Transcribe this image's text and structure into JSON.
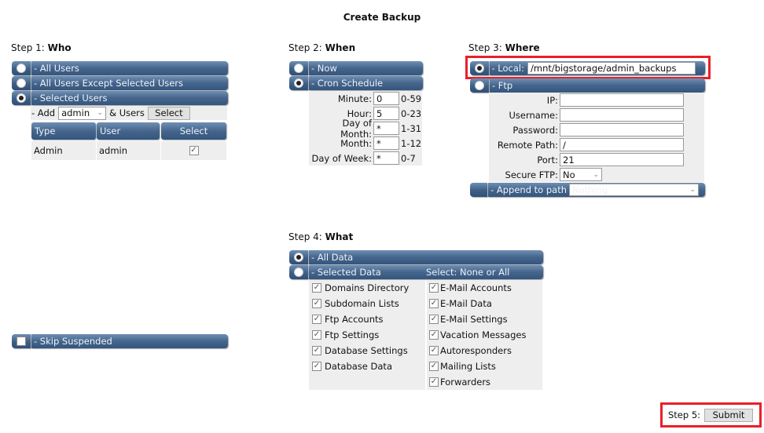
{
  "page": {
    "title": "Create Backup"
  },
  "step1": {
    "label": "Step 1:",
    "heading": "Who",
    "options": [
      {
        "label": "- All Users",
        "selected": false
      },
      {
        "label": "- All Users Except Selected Users",
        "selected": false
      },
      {
        "label": "- Selected Users",
        "selected": true
      }
    ],
    "add_label": "- Add",
    "add_select_value": "admin",
    "and_users_label": "& Users",
    "select_button": "Select",
    "table": {
      "headers": [
        "Type",
        "User",
        "Select"
      ],
      "rows": [
        {
          "type": "Admin",
          "user": "admin",
          "checked": true
        }
      ]
    },
    "skip_suspended": {
      "label": "- Skip Suspended",
      "checked": false
    }
  },
  "step2": {
    "label": "Step 2:",
    "heading": "When",
    "options": [
      {
        "label": "- Now",
        "selected": false
      },
      {
        "label": "- Cron Schedule",
        "selected": true
      }
    ],
    "cron": [
      {
        "label": "Minute:",
        "value": "0",
        "range": "0-59"
      },
      {
        "label": "Hour:",
        "value": "5",
        "range": "0-23"
      },
      {
        "label": "Day of Month:",
        "value": "*",
        "range": "1-31"
      },
      {
        "label": "Month:",
        "value": "*",
        "range": "1-12"
      },
      {
        "label": "Day of Week:",
        "value": "*",
        "range": "0-7"
      }
    ]
  },
  "step3": {
    "label": "Step 3:",
    "heading": "Where",
    "local": {
      "label": "- Local:",
      "value": "/mnt/bigstorage/admin_backups",
      "selected": true
    },
    "ftp": {
      "label": "- Ftp",
      "selected": false
    },
    "ftp_fields": [
      {
        "label": "IP:",
        "value": ""
      },
      {
        "label": "Username:",
        "value": ""
      },
      {
        "label": "Password:",
        "value": ""
      },
      {
        "label": "Remote Path:",
        "value": "/"
      },
      {
        "label": "Port:",
        "value": "21"
      }
    ],
    "secure_ftp": {
      "label": "Secure FTP:",
      "value": "No"
    },
    "append": {
      "label": "- Append to path",
      "value": "Nothing"
    }
  },
  "step4": {
    "label": "Step 4:",
    "heading": "What",
    "options": [
      {
        "label": "- All Data",
        "selected": true
      },
      {
        "label": "- Selected Data",
        "selected": false
      }
    ],
    "select_text": "Select: None or All",
    "left_items": [
      {
        "label": "Domains Directory",
        "checked": true
      },
      {
        "label": "Subdomain Lists",
        "checked": true
      },
      {
        "label": "Ftp Accounts",
        "checked": true
      },
      {
        "label": "Ftp Settings",
        "checked": true
      },
      {
        "label": "Database Settings",
        "checked": true
      },
      {
        "label": "Database Data",
        "checked": true
      }
    ],
    "right_items": [
      {
        "label": "E-Mail Accounts",
        "checked": true
      },
      {
        "label": "E-Mail Data",
        "checked": true
      },
      {
        "label": "E-Mail Settings",
        "checked": true
      },
      {
        "label": "Vacation Messages",
        "checked": true
      },
      {
        "label": "Autoresponders",
        "checked": true
      },
      {
        "label": "Mailing Lists",
        "checked": true
      },
      {
        "label": "Forwarders",
        "checked": true
      }
    ]
  },
  "step5": {
    "label": "Step 5:",
    "submit": "Submit"
  },
  "icons": {
    "check": "✓",
    "chevron": "⌄"
  },
  "colors": {
    "bar": "#45658c",
    "highlight": "#e8202a"
  }
}
